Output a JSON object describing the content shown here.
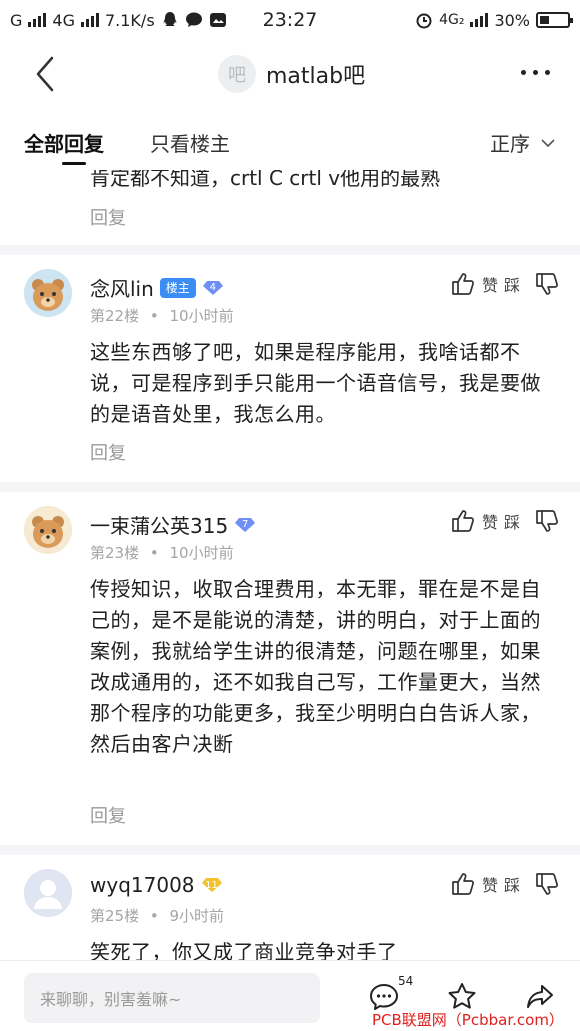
{
  "status_bar": {
    "carrier1": "G",
    "carrier2": "4G",
    "speed": "7.1K/s",
    "time": "23:27",
    "network": "4G₂",
    "battery": "30%"
  },
  "header": {
    "forum_avatar_text": "吧",
    "forum_name": "matlab吧"
  },
  "tabs": {
    "all_replies": "全部回复",
    "op_only": "只看楼主",
    "sort": "正序"
  },
  "partial_post": {
    "text": "肯定都不知道，crtl C crtl v他用的最熟",
    "reply": "回复"
  },
  "actions": {
    "like": "赞",
    "dislike": "踩"
  },
  "posts": [
    {
      "username": "念风lin",
      "badge": "楼主",
      "level": "4",
      "floor": "第22楼",
      "time": "10小时前",
      "content": "这些东西够了吧，如果是程序能用，我啥话都不说，可是程序到手只能用一个语音信号，我是要做的是语音处里，我怎么用。",
      "reply": "回复"
    },
    {
      "username": "一束蒲公英315",
      "level": "7",
      "floor": "第23楼",
      "time": "10小时前",
      "content": "传授知识，收取合理费用，本无罪，罪在是不是自己的，是不是能说的清楚，讲的明白，对于上面的案例，我就给学生讲的很清楚，问题在哪里，如果改成通用的，还不如我自己写，工作量更大，当然那个程序的功能更多，我至少明明白白告诉人家，然后由客户决断",
      "reply": "回复"
    },
    {
      "username": "wyq17008",
      "level": "11",
      "floor": "第25楼",
      "time": "9小时前",
      "content": "笑死了，你又成了商业竞争对手了"
    }
  ],
  "meta_separator": "•",
  "bottom": {
    "placeholder": "来聊聊，别害羞嘛~",
    "comment_count": "54",
    "watermark": "PCB联盟网（Pcbbar.com）"
  },
  "colors": {
    "accent": "#3b8cf5",
    "level_gold": "#f2c12e",
    "level_blue": "#6f8ff5",
    "muted_text": "#a5a5a5",
    "watermark": "#e0201f"
  }
}
